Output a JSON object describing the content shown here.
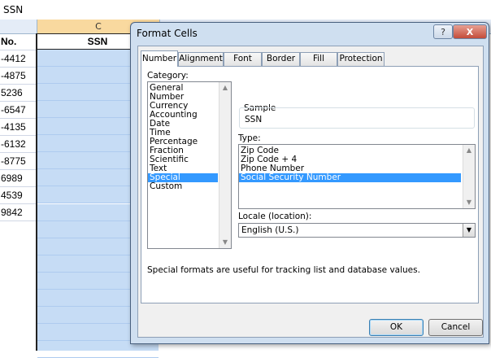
{
  "formula_bar": {
    "value": "SSN"
  },
  "sheet": {
    "column_c_header": "C",
    "column_b_header": "No.",
    "column_b_values": [
      "-4412",
      "-4875",
      "5236",
      "-6547",
      "-4135",
      "-6132",
      "-8775",
      "6989",
      "4539",
      "9842"
    ],
    "column_c_header_cell": "SSN",
    "selection_color": "#c6dcf5"
  },
  "dialog": {
    "title": "Format Cells",
    "help_label": "?",
    "close_label": "X",
    "tabs": [
      "Number",
      "Alignment",
      "Font",
      "Border",
      "Fill",
      "Protection"
    ],
    "active_tab": "Number",
    "category_label": "Category:",
    "categories": [
      "General",
      "Number",
      "Currency",
      "Accounting",
      "Date",
      "Time",
      "Percentage",
      "Fraction",
      "Scientific",
      "Text",
      "Special",
      "Custom"
    ],
    "selected_category": "Special",
    "sample_label": "Sample",
    "sample_value": "SSN",
    "type_label": "Type:",
    "types": [
      "Zip Code",
      "Zip Code + 4",
      "Phone Number",
      "Social Security Number"
    ],
    "selected_type": "Social Security Number",
    "locale_label": "Locale (location):",
    "locale_value": "English (U.S.)",
    "description": "Special formats are useful for tracking list and database values.",
    "ok_label": "OK",
    "cancel_label": "Cancel",
    "selection_color": "#3399ff"
  }
}
